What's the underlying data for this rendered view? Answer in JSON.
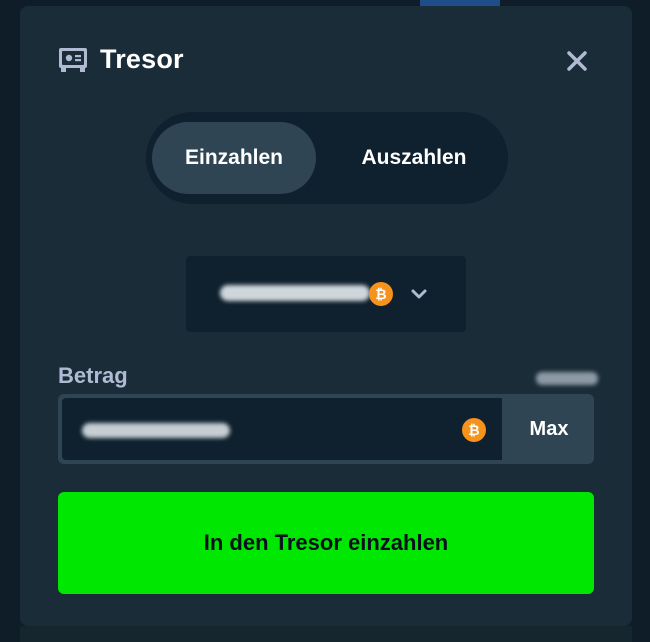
{
  "modal": {
    "title": "Tresor",
    "icon": "vault-icon",
    "close_icon": "close-icon"
  },
  "tabs": [
    {
      "label": "Einzahlen",
      "active": true
    },
    {
      "label": "Auszahlen",
      "active": false
    }
  ],
  "currency_select": {
    "selected_value": "",
    "currency_icon": "bitcoin-icon",
    "coin_glyph": "₿",
    "dropdown_icon": "chevron-down-icon"
  },
  "amount": {
    "label": "Betrag",
    "value": "",
    "currency_icon": "bitcoin-icon",
    "coin_glyph": "₿",
    "max_label": "Max"
  },
  "submit": {
    "label": "In den Tresor einzahlen"
  },
  "colors": {
    "page_bg": "#0f1d29",
    "modal_bg": "#1a2c38",
    "dark_bg": "#0f212e",
    "active_tab": "#2f4553",
    "primary_green": "#00e701",
    "bitcoin_orange": "#f7931a",
    "label_gray": "#b1bad3"
  }
}
